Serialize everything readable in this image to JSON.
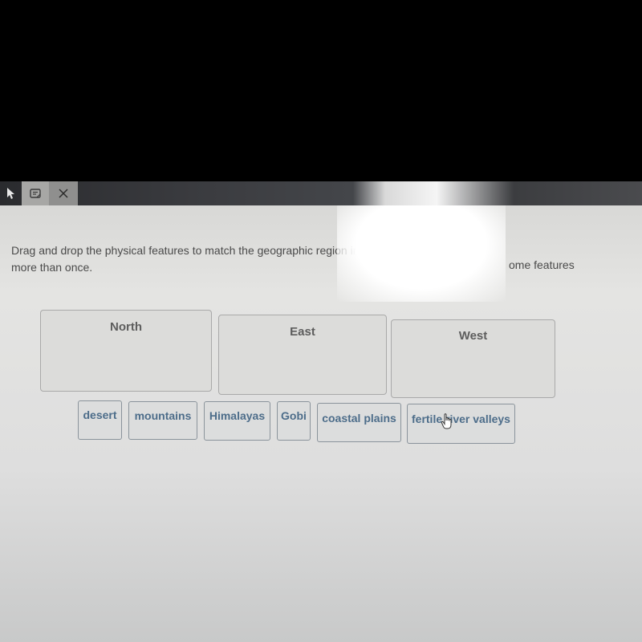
{
  "toolbar": {
    "tools": [
      {
        "name": "pointer",
        "icon": "pointer-arrow-icon"
      },
      {
        "name": "notes",
        "icon": "notes-icon"
      },
      {
        "name": "close",
        "icon": "close-icon",
        "glyph": "✕"
      }
    ]
  },
  "question": {
    "instructions_line1": "Drag and drop the physical features to match the geographic region in",
    "instructions_line1_end": "ome features",
    "instructions_line2": "more than once."
  },
  "drop_zones": [
    {
      "label": "North"
    },
    {
      "label": "East"
    },
    {
      "label": "West"
    }
  ],
  "draggable_items": [
    {
      "label": "desert"
    },
    {
      "label": "mountains"
    },
    {
      "label": "Himalayas"
    },
    {
      "label": "Gobi"
    },
    {
      "label": "coastal plains"
    },
    {
      "label": "fertile river valleys"
    }
  ],
  "colors": {
    "chip_text": "#4d6d8a",
    "zone_title": "#5d5d5d",
    "instruction_text": "#4a4a4a"
  }
}
